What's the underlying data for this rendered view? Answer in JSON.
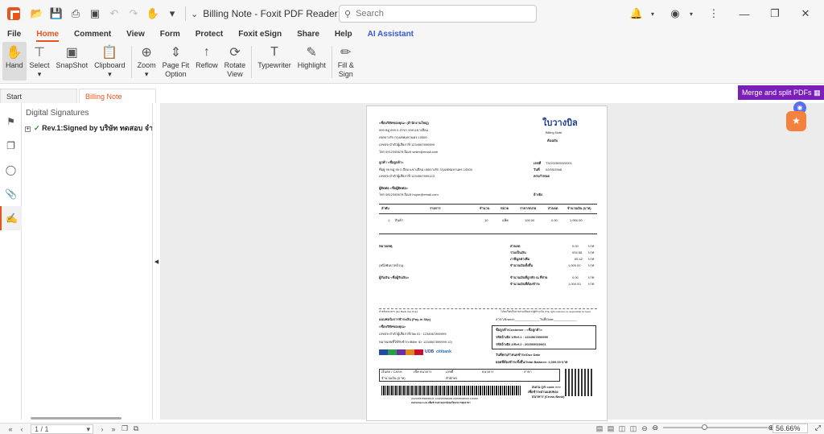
{
  "app": {
    "window_title": "Billing Note - Foxit PDF Reader",
    "search_placeholder": "Search"
  },
  "menu": [
    "File",
    "Home",
    "Comment",
    "View",
    "Form",
    "Protect",
    "Foxit eSign",
    "Share",
    "Help",
    "AI Assistant"
  ],
  "ribbon": {
    "hand": "Hand",
    "select": "Select",
    "snapshot": "SnapShot",
    "clipboard": "Clipboard",
    "zoom": "Zoom",
    "page_fit_1": "Page Fit",
    "page_fit_2": "Option",
    "reflow": "Reflow",
    "rotate_1": "Rotate",
    "rotate_2": "View",
    "typewriter": "Typewriter",
    "highlight": "Highlight",
    "fill_1": "Fill &",
    "fill_2": "Sign"
  },
  "tabs": {
    "start": "Start",
    "billing": "Billing Note"
  },
  "promo": "Merge and split PDFs",
  "panel": {
    "title": "Digital Signatures",
    "node": "Rev.1:Signed by บริษัท ทดสอบ จำกัด ("
  },
  "status": {
    "page": "1 / 1",
    "zoom": "56.66%"
  },
  "doc": {
    "company": "<ชื่อบริษัทของคุณ> (สำนักงานใหญ่)",
    "addr1": "999 หมู่ 999 ถ.สาขา 999 แขวงสีลม",
    "addr2": "เขตบางรัก กรุงเทพมหานคร 10500",
    "taxid": "เลขประจำตัวผู้เสียภาษี 1234567890999",
    "contact": "โทร 0912345678 อีเมล seller@email.com",
    "title_th": "ใบวางบิล",
    "title_en": "Billing Note",
    "original": "ต้นฉบับ",
    "customer": "ลูกค้า <ชื่อลูกค้า>",
    "cust_addr": "ที่อยู่ 99 หมู่ 99 ถ.สีลม แขวงสีลม เขตบางรัก กรุงเทพมหานคร 10500",
    "cust_tax": "เลขประจำตัวผู้เสียภาษี 1234567890123",
    "doc_no_label": "เลขที่",
    "doc_no": "TIV202505020001",
    "date_label": "วันที่",
    "date": "02/05/2568",
    "terms_label": "ครบกำหนด",
    "contact_name": "ผู้ติดต่อ <ชื่อผู้ติดต่อ>",
    "contact_tel": "โทร 0812345678 อีเมล buyer@email.com",
    "approver": "อ้างอิง",
    "table_headers": [
      "ลำดับ",
      "รายการ",
      "จำนวน",
      "หน่วย",
      "ราคา/หน่วย",
      "ส่วนลด",
      "จำนวนเงิน (บาท)"
    ],
    "row": [
      "1",
      "สินค้า",
      "10",
      "แพ็ค",
      "100.00",
      "0.00",
      "1,000.00"
    ],
    "remark": "หมายเหตุ",
    "sum_labels": [
      "ส่วนลด",
      "รวมเป็นเงิน",
      "ภาษีมูลค่าเพิ่ม",
      "จำนวนเงินทั้งสิ้น"
    ],
    "sum_values": [
      "0.00",
      "934.58",
      "65.42",
      "1,000.00"
    ],
    "baht": "บาท",
    "words": "(หนึ่งพันบาทถ้วน)",
    "withhold_labels": [
      "จำนวนเงินที่ถูกหัก ณ ที่จ่าย",
      "จำนวนเงินที่ต้องชำระ"
    ],
    "withhold_values": [
      "0.00",
      "1,000.00"
    ],
    "receiver": "ผู้รับเงิน <ชื่อผู้รับเงิน>",
    "slip_left": "สำหรับธนาคาร (For Bank Use Only)",
    "slip_right": "โปรดเรียกเก็บค่าธรรมเนียมจากผู้ชำระเงิน (The right customer is responsible for fees)",
    "payin": "แบบฟอร์มการชำระเงิน (Pay-in Slip)",
    "branch": "สาขา/Branch______________วันที่/Date_____________",
    "pay_company": "<ชื่อบริษัทของคุณ>",
    "pay_tax": "เลขประจำตัวผู้เสียภาษี/Tax ID : 1234567890999",
    "pay_biller": "หมายเลขที่ใช้รับชำระ/Biller ID: 1234567890999 12)",
    "cust_box_1": "ชื่อลูกค้า/Customer : <ชื่อลูกค้า>",
    "cust_box_2": "รหัสอ้างอิง 1/Ref.1 : 1234567890999",
    "cust_box_3": "รหัสอ้างอิง 2/Ref.2 : 202505020001",
    "bank_name": "UOB",
    "bank_name2": "citibank",
    "due": "วันที่ครบกำหนดชำระ/Due Date",
    "total_bal": "ยอดที่ต้องชำระทั้งสิ้น/Total Balance: 1,000.00 บาท",
    "cash": "เงินสด / CASH",
    "cheque": "เช็ค ธนาคาร",
    "cheque_no": "เลขที่",
    "bank": "ธนาคาร",
    "branch2": "สาขา",
    "amount_num": "จำนวนเงิน (บาท)",
    "amount_words": "ตัวอักษร",
    "scan": "สแกน QR code >>>",
    "scan2": "เพื่อชำระผ่านแอปของ",
    "scan3": "ธนาคาร (Cross Bank)",
    "barcode_no": "|01234567890999111 1234567890999 202505020001 100000",
    "barcode_note": "สแกน Barcode เพื่อชำระผ่านเคาน์เตอร์ธนาคารทุกสาขา"
  }
}
